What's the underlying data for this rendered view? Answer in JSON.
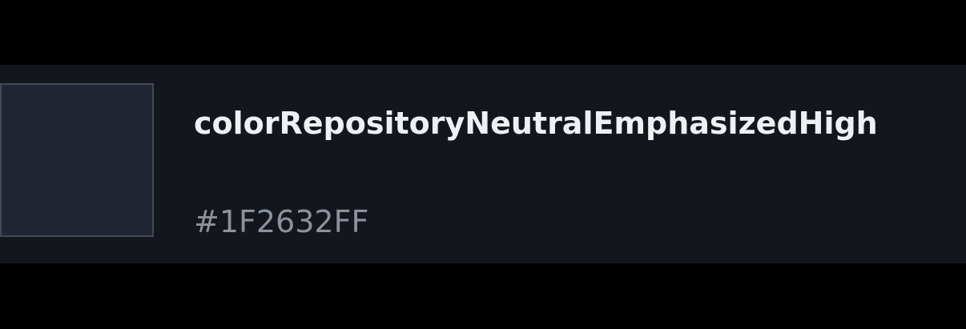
{
  "token": {
    "name": "colorRepositoryNeutralEmphasizedHigh",
    "value": "#1F2632FF",
    "swatch_color": "#1F2632",
    "swatch_border_color": "#424A56"
  },
  "theme": {
    "page_background": "#000000",
    "row_background": "#13161C",
    "name_color": "#EEF0F4",
    "value_color": "#8C929C"
  }
}
